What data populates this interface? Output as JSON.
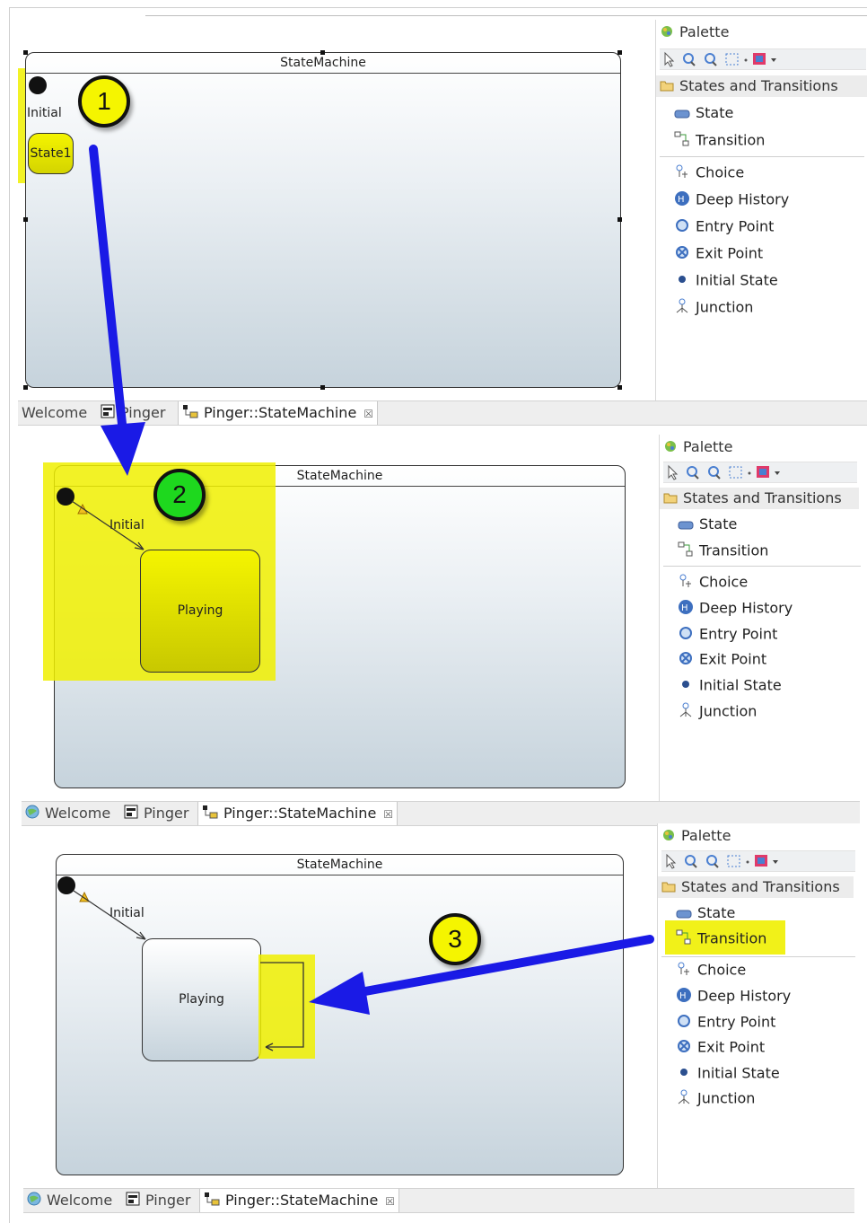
{
  "palette": {
    "title": "Palette",
    "drawer_label": "States and Transitions",
    "items_top": [
      "State",
      "Transition"
    ],
    "items_bottom": [
      "Choice",
      "Deep History",
      "Entry Point",
      "Exit Point",
      "Initial State",
      "Junction"
    ]
  },
  "diagram": {
    "state_machine_title": "StateMachine",
    "initial_label": "Initial",
    "state1_label": "State1",
    "playing_label": "Playing"
  },
  "tabs": {
    "welcome": "Welcome",
    "pinger": "Pinger",
    "state_machine": "Pinger::StateMachine",
    "close_glyph": "☒"
  },
  "annotations": {
    "step1": "1",
    "step2": "2",
    "step3": "3",
    "highlight_color": "#f0f000",
    "arrow_color": "#1a1ae6",
    "badge_yellow": "#f5f500",
    "badge_green": "#1ed81e"
  }
}
